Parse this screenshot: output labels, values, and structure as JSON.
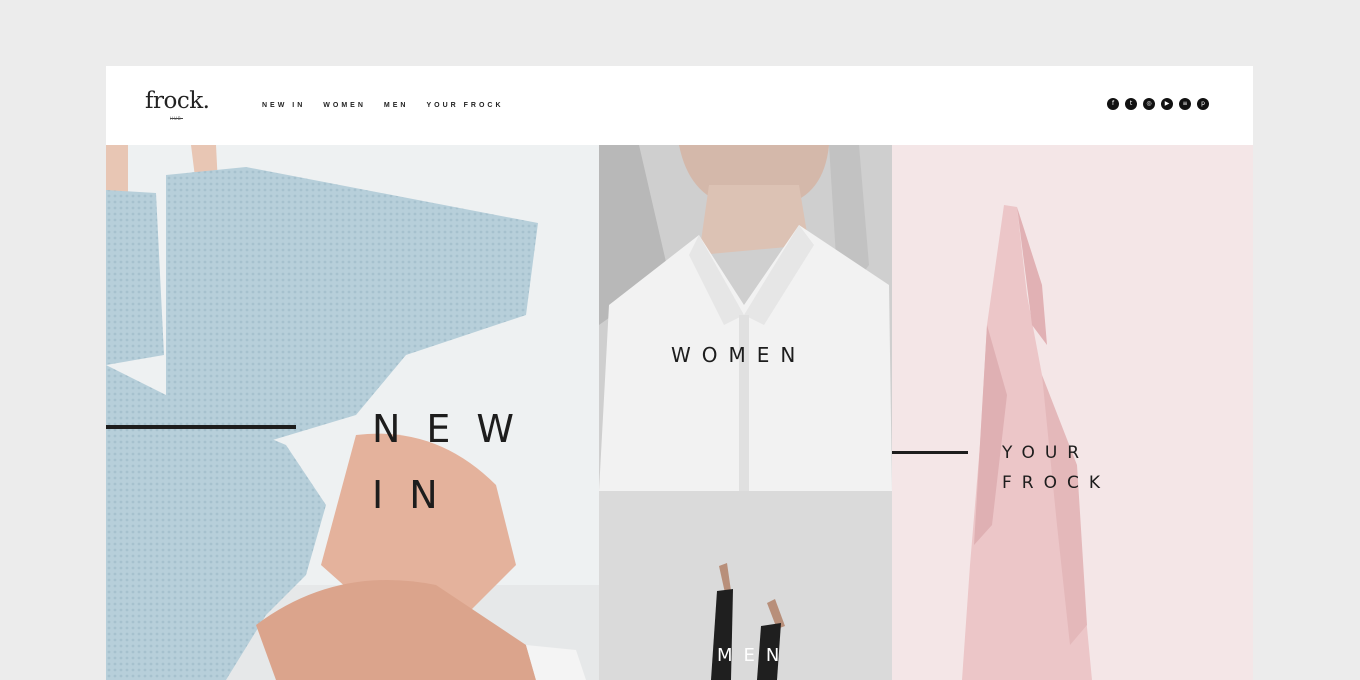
{
  "brand": {
    "logo": "frock.",
    "logo_sub": "HUB"
  },
  "nav": {
    "items": [
      {
        "label": "NEW IN"
      },
      {
        "label": "WOMEN"
      },
      {
        "label": "MEN"
      },
      {
        "label": "YOUR FROCK"
      }
    ]
  },
  "social": {
    "icons": [
      "facebook-icon",
      "twitter-icon",
      "instagram-icon",
      "youtube-icon",
      "spotify-icon",
      "pinterest-icon"
    ]
  },
  "panels": {
    "new_in": {
      "line1": "NEW",
      "line2": "IN"
    },
    "women": {
      "label": "WOMEN"
    },
    "men": {
      "label": "MEN"
    },
    "your_frock": {
      "line1": "YOUR",
      "line2": "FROCK"
    }
  },
  "colors": {
    "page_bg": "#ececec",
    "text": "#1d1d1d",
    "frock_bg": "#f3e4e5",
    "new_bg": "#e8ecee"
  }
}
